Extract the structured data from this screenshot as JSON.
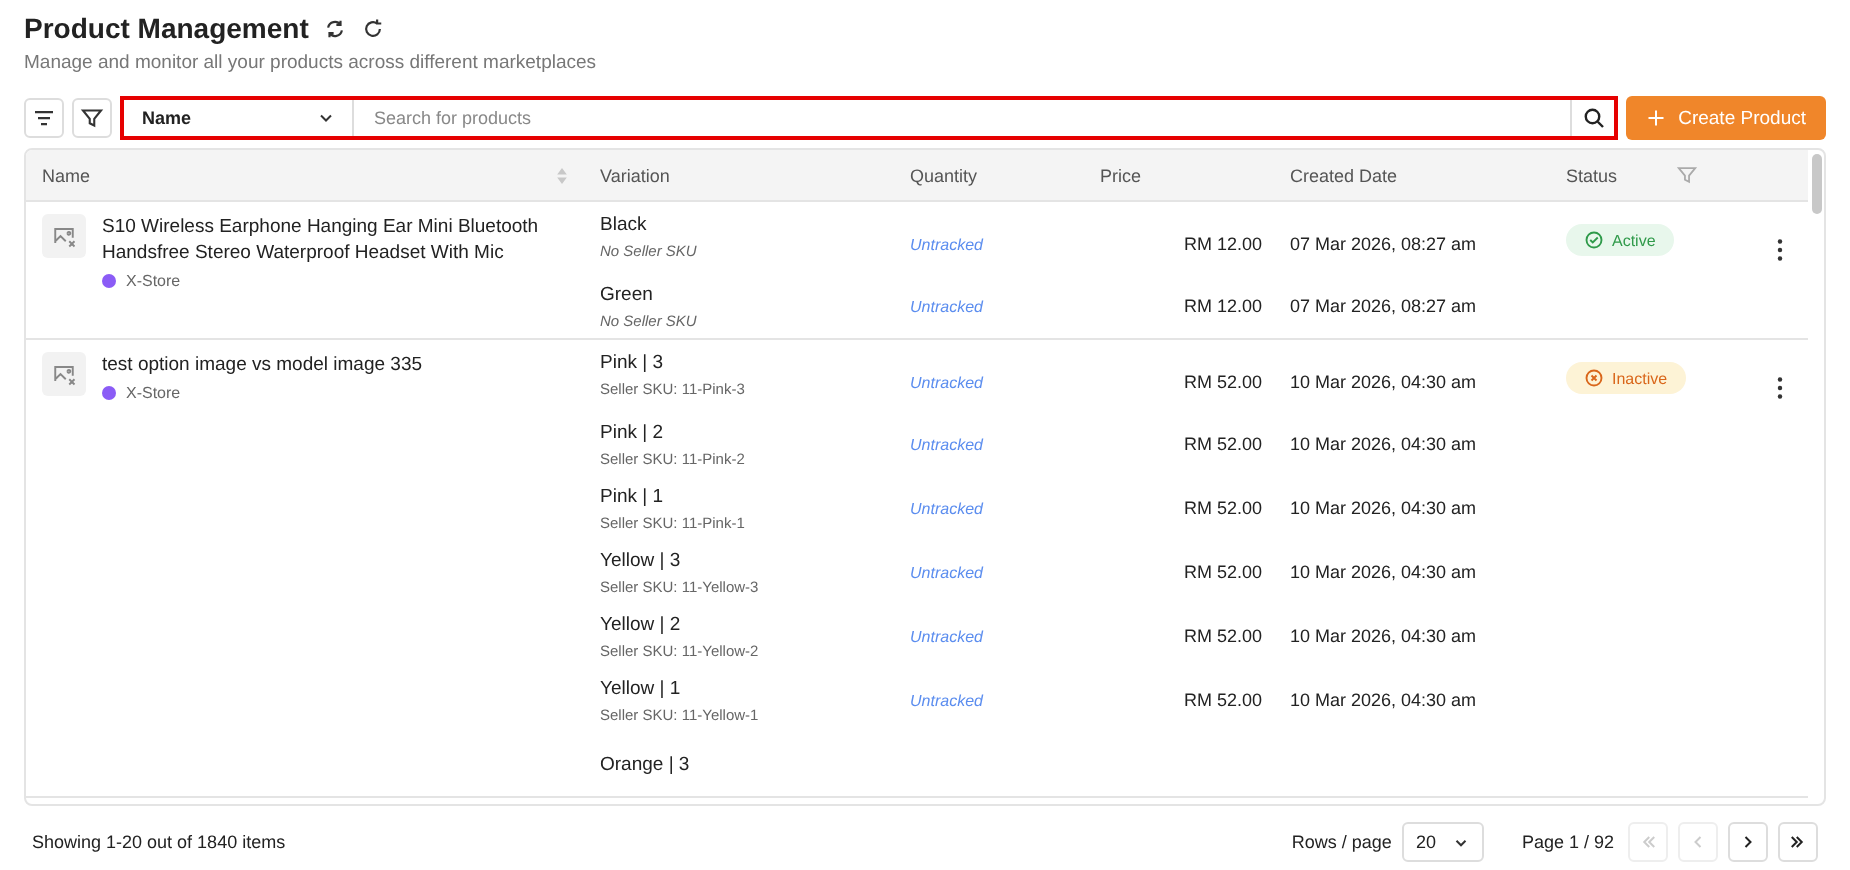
{
  "header": {
    "title": "Product Management",
    "subtitle": "Manage and monitor all your products across different marketplaces"
  },
  "toolbar": {
    "search_by": "Name",
    "placeholder": "Search for products",
    "create_button": "Create Product"
  },
  "table": {
    "columns": [
      {
        "label": "Name",
        "kind": "sort"
      },
      {
        "label": "Variation",
        "kind": "plain"
      },
      {
        "label": "Quantity",
        "kind": "plain"
      },
      {
        "label": "Price",
        "kind": "plain"
      },
      {
        "label": "Created Date",
        "kind": "plain"
      },
      {
        "label": "Status",
        "kind": "filter"
      }
    ],
    "products": [
      {
        "name": "S10 Wireless Earphone Hanging Ear Mini Bluetooth Handsfree Stereo Waterproof Headset With Mic",
        "store": {
          "name": "X-Store",
          "color": "#8b5cf6"
        },
        "status": {
          "label": "Active",
          "kind": "active"
        },
        "variations": [
          {
            "name": "Black",
            "sku": "No Seller SKU",
            "sku_missing": true,
            "quantity": "Untracked",
            "price": "RM 12.00",
            "date": "07 Mar 2026, 08:27 am"
          },
          {
            "name": "Green",
            "sku": "No Seller SKU",
            "sku_missing": true,
            "quantity": "Untracked",
            "price": "RM 12.00",
            "date": "07 Mar 2026, 08:27 am"
          }
        ]
      },
      {
        "name": "test option image vs model image 335",
        "store": {
          "name": "X-Store",
          "color": "#8b5cf6"
        },
        "status": {
          "label": "Inactive",
          "kind": "inactive"
        },
        "variations": [
          {
            "name": "Pink | 3",
            "sku": "Seller SKU: 11-Pink-3",
            "sku_missing": false,
            "quantity": "Untracked",
            "price": "RM 52.00",
            "date": "10 Mar 2026, 04:30 am"
          },
          {
            "name": "Pink | 2",
            "sku": "Seller SKU: 11-Pink-2",
            "sku_missing": false,
            "quantity": "Untracked",
            "price": "RM 52.00",
            "date": "10 Mar 2026, 04:30 am"
          },
          {
            "name": "Pink | 1",
            "sku": "Seller SKU: 11-Pink-1",
            "sku_missing": false,
            "quantity": "Untracked",
            "price": "RM 52.00",
            "date": "10 Mar 2026, 04:30 am"
          },
          {
            "name": "Yellow | 3",
            "sku": "Seller SKU: 11-Yellow-3",
            "sku_missing": false,
            "quantity": "Untracked",
            "price": "RM 52.00",
            "date": "10 Mar 2026, 04:30 am"
          },
          {
            "name": "Yellow | 2",
            "sku": "Seller SKU: 11-Yellow-2",
            "sku_missing": false,
            "quantity": "Untracked",
            "price": "RM 52.00",
            "date": "10 Mar 2026, 04:30 am"
          },
          {
            "name": "Yellow | 1",
            "sku": "Seller SKU: 11-Yellow-1",
            "sku_missing": false,
            "quantity": "Untracked",
            "price": "RM 52.00",
            "date": "10 Mar 2026, 04:30 am"
          },
          {
            "name": "Orange | 3"
          }
        ]
      }
    ]
  },
  "footer": {
    "summary": "Showing 1-20 out of 1840 items",
    "rows_label": "Rows / page",
    "rows_value": "20",
    "page": "Page 1 / 92",
    "nav": [
      {
        "kind": "first",
        "disabled": true
      },
      {
        "kind": "prev",
        "disabled": true
      },
      {
        "kind": "next",
        "disabled": false
      },
      {
        "kind": "last",
        "disabled": false
      }
    ]
  }
}
